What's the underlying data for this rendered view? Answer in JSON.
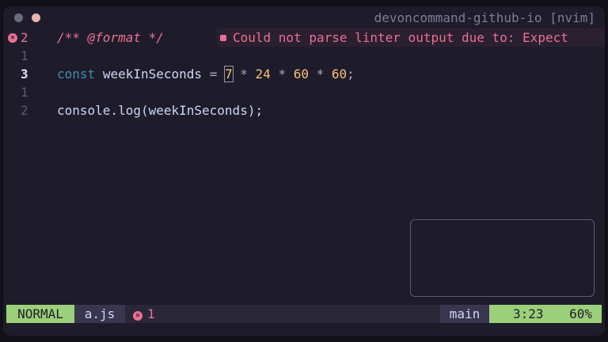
{
  "window": {
    "title": "devoncommand-github-io [nvim]"
  },
  "editor": {
    "lines": [
      {
        "number": "2",
        "sign": "×",
        "comment": "/** @format */",
        "diagnostic": "Could not parse linter output due to: Expect"
      },
      {
        "number": "1"
      },
      {
        "number": "3",
        "keyword": "const",
        "ident": "weekInSeconds",
        "assign": "=",
        "n1": "7",
        "mul1": "*",
        "n2": "24",
        "mul2": "*",
        "n3": "60",
        "mul3": "*",
        "n4": "60",
        "semi": ";"
      },
      {
        "number": "1"
      },
      {
        "number": "2",
        "code": "console.log(weekInSeconds);"
      }
    ]
  },
  "statusline": {
    "mode": "NORMAL",
    "file": "a.js",
    "error_icon": "×",
    "error_count": "1",
    "branch": "main",
    "position": "3:23",
    "percent": "60%"
  },
  "colors": {
    "background": "#1e1c2a",
    "error": "#eb6f92",
    "keyword": "#3e8fb0",
    "number": "#f6c177",
    "mode_green": "#9ccf7a"
  },
  "icons": {
    "error_sign": "error-icon",
    "diagnostic_marker": "diagnostic-square-icon"
  }
}
